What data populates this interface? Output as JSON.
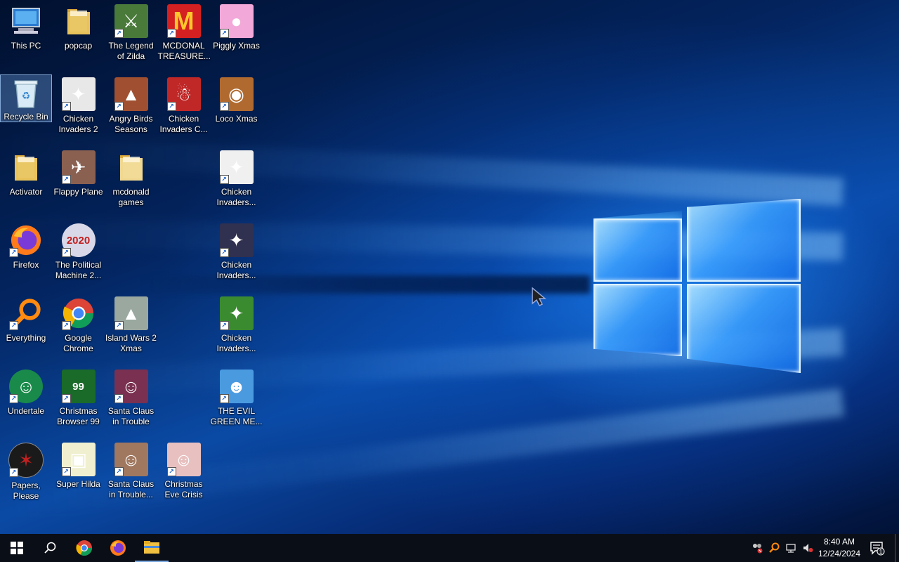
{
  "desktop": {
    "icons": [
      {
        "label": "This PC",
        "icon": "computer-icon",
        "color": "#3a86d9",
        "shortcut": false
      },
      {
        "label": "popcap",
        "icon": "folder-icon",
        "color": "#e8c25a",
        "shortcut": false
      },
      {
        "label": "The Legend\nof Zilda",
        "icon": "game-icon",
        "color": "#4a7a3a",
        "shortcut": true
      },
      {
        "label": "MCDONAL\nTREASURE...",
        "icon": "mcdonalds-icon",
        "color": "#d42020",
        "shortcut": true
      },
      {
        "label": "Piggly Xmas",
        "icon": "pig-icon",
        "color": "#f2a8d8",
        "shortcut": true
      },
      {
        "label": "Recycle Bin",
        "icon": "recycle-bin-icon",
        "color": "#bfd8ec",
        "shortcut": false
      },
      {
        "label": "Chicken\nInvaders 2",
        "icon": "chicken-icon",
        "color": "#e8e8e8",
        "shortcut": true
      },
      {
        "label": "Angry Birds\nSeasons",
        "icon": "angry-birds-icon",
        "color": "#a05030",
        "shortcut": true
      },
      {
        "label": "Chicken\nInvaders C...",
        "icon": "snowman-icon",
        "color": "#c02828",
        "shortcut": true
      },
      {
        "label": "Loco Xmas",
        "icon": "bear-icon",
        "color": "#b06a30",
        "shortcut": true
      },
      {
        "label": "Activator",
        "icon": "folder-icon",
        "color": "#e8c25a",
        "shortcut": false
      },
      {
        "label": "Flappy Plane",
        "icon": "plane-icon",
        "color": "#8a6050",
        "shortcut": true
      },
      {
        "label": "mcdonald\ngames",
        "icon": "folder-icon",
        "color": "#f0d890",
        "shortcut": false
      },
      {
        "label": "Chicken\nInvaders...",
        "icon": "chicken-icon",
        "color": "#f0f0f0",
        "shortcut": true
      },
      {
        "label": "Firefox",
        "icon": "firefox-icon",
        "color": "#ff7a1a",
        "shortcut": true
      },
      {
        "label": "The Political\nMachine 2...",
        "icon": "political-icon",
        "color": "#d8d8e8",
        "shortcut": true
      },
      {
        "label": "Chicken\nInvaders...",
        "icon": "chicken-icon",
        "color": "#303050",
        "shortcut": true
      },
      {
        "label": "Everything",
        "icon": "search-magnifier-icon",
        "color": "#ff8a10",
        "shortcut": true
      },
      {
        "label": "Google\nChrome",
        "icon": "chrome-icon",
        "color": "#4caf50",
        "shortcut": true
      },
      {
        "label": "Island Wars 2\nXmas",
        "icon": "island-icon",
        "color": "#9aa8a0",
        "shortcut": true
      },
      {
        "label": "Chicken\nInvaders...",
        "icon": "chicken-icon",
        "color": "#3a8a30",
        "shortcut": true
      },
      {
        "label": "Undertale",
        "icon": "undertale-icon",
        "color": "#1a8a4a",
        "shortcut": true
      },
      {
        "label": "Christmas\nBrowser 99",
        "icon": "tree-icon",
        "color": "#1a6a2a",
        "shortcut": true
      },
      {
        "label": "Santa Claus\nin Trouble",
        "icon": "santa-icon",
        "color": "#7a3050",
        "shortcut": true
      },
      {
        "label": "THE EVIL\nGREEN ME...",
        "icon": "messenger-icon",
        "color": "#4a9ae0",
        "shortcut": true
      },
      {
        "label": "Papers,\nPlease",
        "icon": "papers-please-icon",
        "color": "#1a1a1a",
        "shortcut": true
      },
      {
        "label": "Super Hilda",
        "icon": "pixel-dog-icon",
        "color": "#f0f0d0",
        "shortcut": true
      },
      {
        "label": "Santa Claus\nin Trouble...",
        "icon": "santa-icon",
        "color": "#a07860",
        "shortcut": true
      },
      {
        "label": "Christmas\nEve Crisis",
        "icon": "santa-face-icon",
        "color": "#e8c0c0",
        "shortcut": true
      }
    ]
  },
  "taskbar": {
    "start_icon": "windows-start-icon",
    "search_icon": "search-icon",
    "pinned": [
      {
        "name": "chrome-taskbar-icon"
      },
      {
        "name": "firefox-taskbar-icon"
      },
      {
        "name": "file-explorer-taskbar-icon"
      }
    ],
    "clock_time": "8:40 AM",
    "clock_date": "12/24/2024",
    "notification_count": "1"
  },
  "colors": {
    "taskbar_bg": "#0a0e17",
    "desktop_accent": "#0a4aa5"
  }
}
